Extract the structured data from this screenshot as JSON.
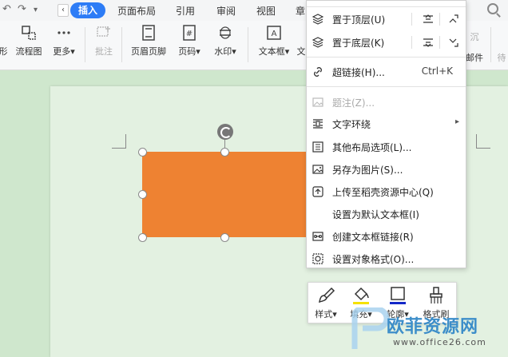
{
  "tabs": {
    "items": [
      "插入",
      "页面布局",
      "引用",
      "审阅",
      "视图",
      "章"
    ],
    "active": "插入"
  },
  "ribbon": {
    "buttons": [
      {
        "label": "形",
        "icon": "shape-icon"
      },
      {
        "label": "流程图",
        "icon": "flowchart-icon"
      },
      {
        "label": "更多",
        "icon": "more-icon"
      },
      {
        "label": "批注",
        "icon": "comment-icon"
      },
      {
        "label": "页眉页脚",
        "icon": "header-footer-icon"
      },
      {
        "label": "页码",
        "icon": "page-number-icon"
      },
      {
        "label": "水印",
        "icon": "watermark-icon"
      },
      {
        "label": "文本框",
        "icon": "textbox-icon"
      },
      {
        "label": "文",
        "icon": "text-icon"
      },
      {
        "label": "沉",
        "icon": "sink-icon"
      },
      {
        "label": "邮件",
        "icon": "mail-icon"
      },
      {
        "label": "待",
        "icon": "pending-icon"
      }
    ]
  },
  "menu": {
    "items": [
      {
        "label": "置于顶层(U)",
        "icon": "bring-to-front-icon"
      },
      {
        "label": "置于底层(K)",
        "icon": "send-to-back-icon"
      },
      {
        "label": "超链接(H)...",
        "icon": "hyperlink-icon",
        "shortcut": "Ctrl+K"
      },
      {
        "label": "题注(Z)...",
        "icon": "caption-icon",
        "disabled": true
      },
      {
        "label": "文字环绕",
        "icon": "text-wrap-icon",
        "submenu": true
      },
      {
        "label": "其他布局选项(L)...",
        "icon": "layout-options-icon"
      },
      {
        "label": "另存为图片(S)...",
        "icon": "save-as-image-icon"
      },
      {
        "label": "上传至稻壳资源中心(Q)",
        "icon": "upload-icon"
      },
      {
        "label": "设置为默认文本框(I)",
        "icon": ""
      },
      {
        "label": "创建文本框链接(R)",
        "icon": "textbox-link-icon"
      },
      {
        "label": "设置对象格式(O)...",
        "icon": "object-format-icon"
      }
    ]
  },
  "mini_toolbar": {
    "buttons": [
      {
        "label": "样式",
        "icon": "style-brush-icon",
        "dropdown": true
      },
      {
        "label": "填充",
        "icon": "fill-bucket-icon",
        "dropdown": true,
        "color": "#f5e100"
      },
      {
        "label": "轮廓",
        "icon": "outline-icon",
        "dropdown": true,
        "color": "#1428c8"
      },
      {
        "label": "格式刷",
        "icon": "format-painter-icon",
        "dropdown": false
      }
    ]
  },
  "shape": {
    "fill": "#ee8232"
  },
  "colors": {
    "accent": "#2d7cf6",
    "doc_bg": "#cfe7cd",
    "page": "#e3f1e1"
  },
  "watermark": {
    "title": "欧菲资源网",
    "url": "www.office26.com"
  }
}
